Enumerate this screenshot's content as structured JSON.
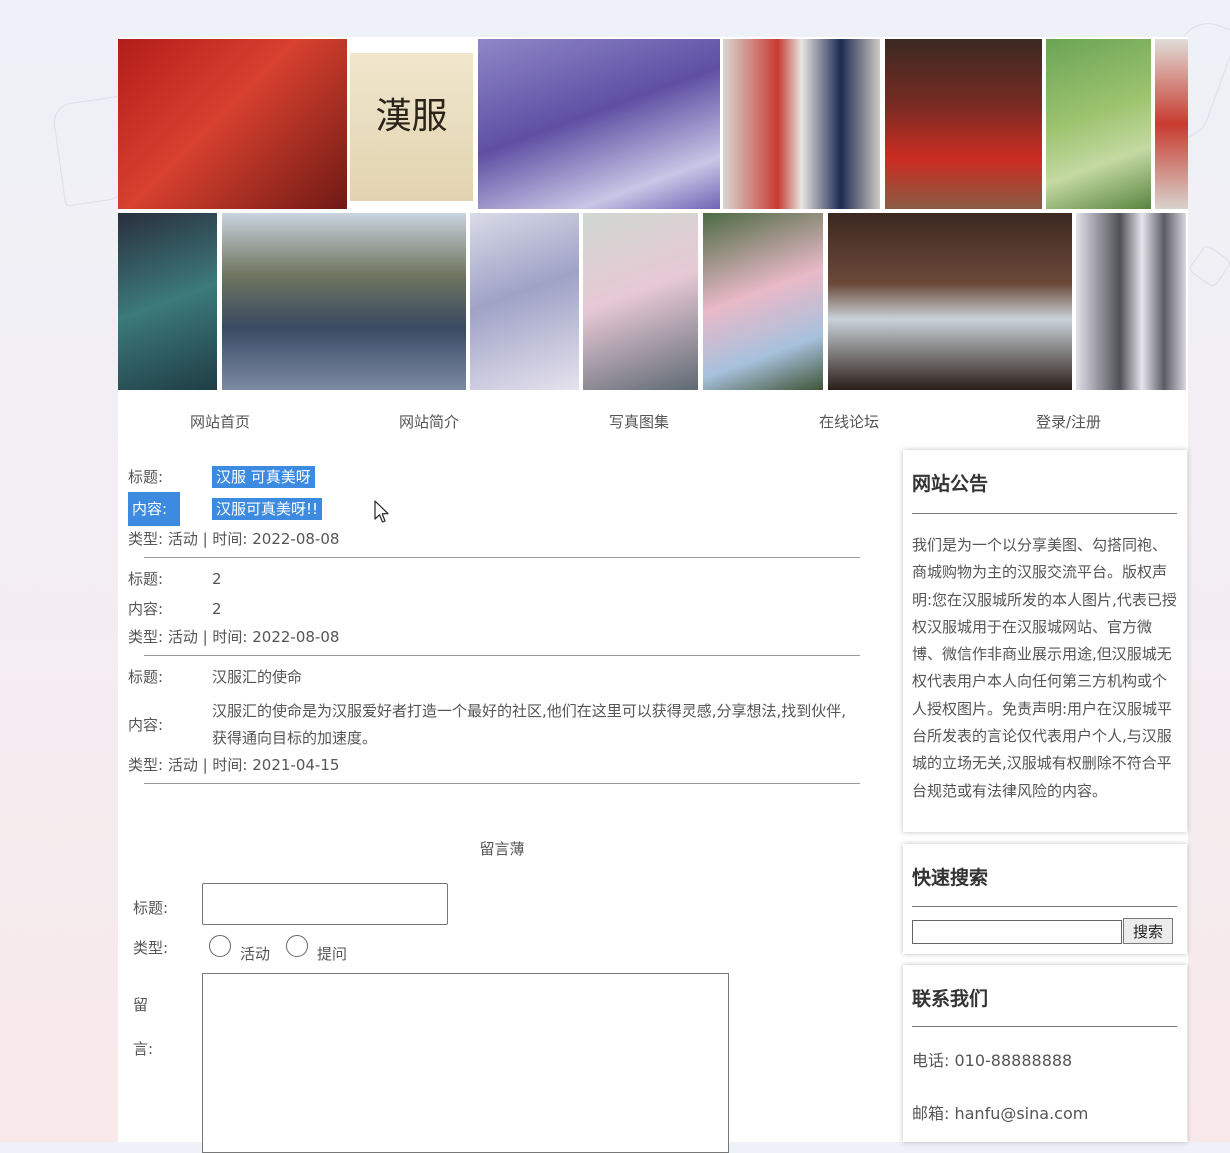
{
  "banner": {
    "scroll_text": "漢服"
  },
  "nav": [
    "网站首页",
    "网站简介",
    "写真图集",
    "在线论坛",
    "登录/注册"
  ],
  "posts": [
    {
      "title_label": "标题:",
      "title": "汉服 可真美呀",
      "content_label": "内容:",
      "content": "汉服可真美呀!!",
      "meta": "类型: 活动 | 时间: 2022-08-08"
    },
    {
      "title_label": "标题:",
      "title": "2",
      "content_label": "内容:",
      "content": "2",
      "meta": "类型: 活动 | 时间: 2022-08-08"
    },
    {
      "title_label": "标题:",
      "title": "汉服汇的使命",
      "content_label": "内容:",
      "content": "汉服汇的使命是为汉服爱好者打造一个最好的社区,他们在这里可以获得灵感,分享想法,找到伙伴,获得通向目标的加速度。",
      "meta": "类型: 活动 | 时间: 2021-04-15"
    }
  ],
  "guestbook": {
    "title": "留言薄",
    "title_label": "标题:",
    "type_label": "类型:",
    "type_options": [
      "活动",
      "提问"
    ],
    "message_label_1": "留",
    "message_label_2": "言:"
  },
  "sidebar": {
    "notice": {
      "heading": "网站公告",
      "text": "我们是为一个以分享美图、勾搭同袍、商城购物为主的汉服交流平台。版权声明:您在汉服城所发的本人图片,代表已授权汉服城用于在汉服城网站、官方微博、微信作非商业展示用途,但汉服城无权代表用户本人向任何第三方机构或个人授权图片。免责声明:用户在汉服城平台所发表的言论仅代表用户个人,与汉服城的立场无关,汉服城有权删除不符合平台规范或有法律风险的内容。"
    },
    "search": {
      "heading": "快速搜索",
      "button": "搜索"
    },
    "contact": {
      "heading": "联系我们",
      "phone": "电话: 010-88888888",
      "email": "邮箱: hanfu@sina.com"
    }
  },
  "colors": {
    "selection": "#3d8be0",
    "text": "#555555",
    "heading": "#333333"
  }
}
